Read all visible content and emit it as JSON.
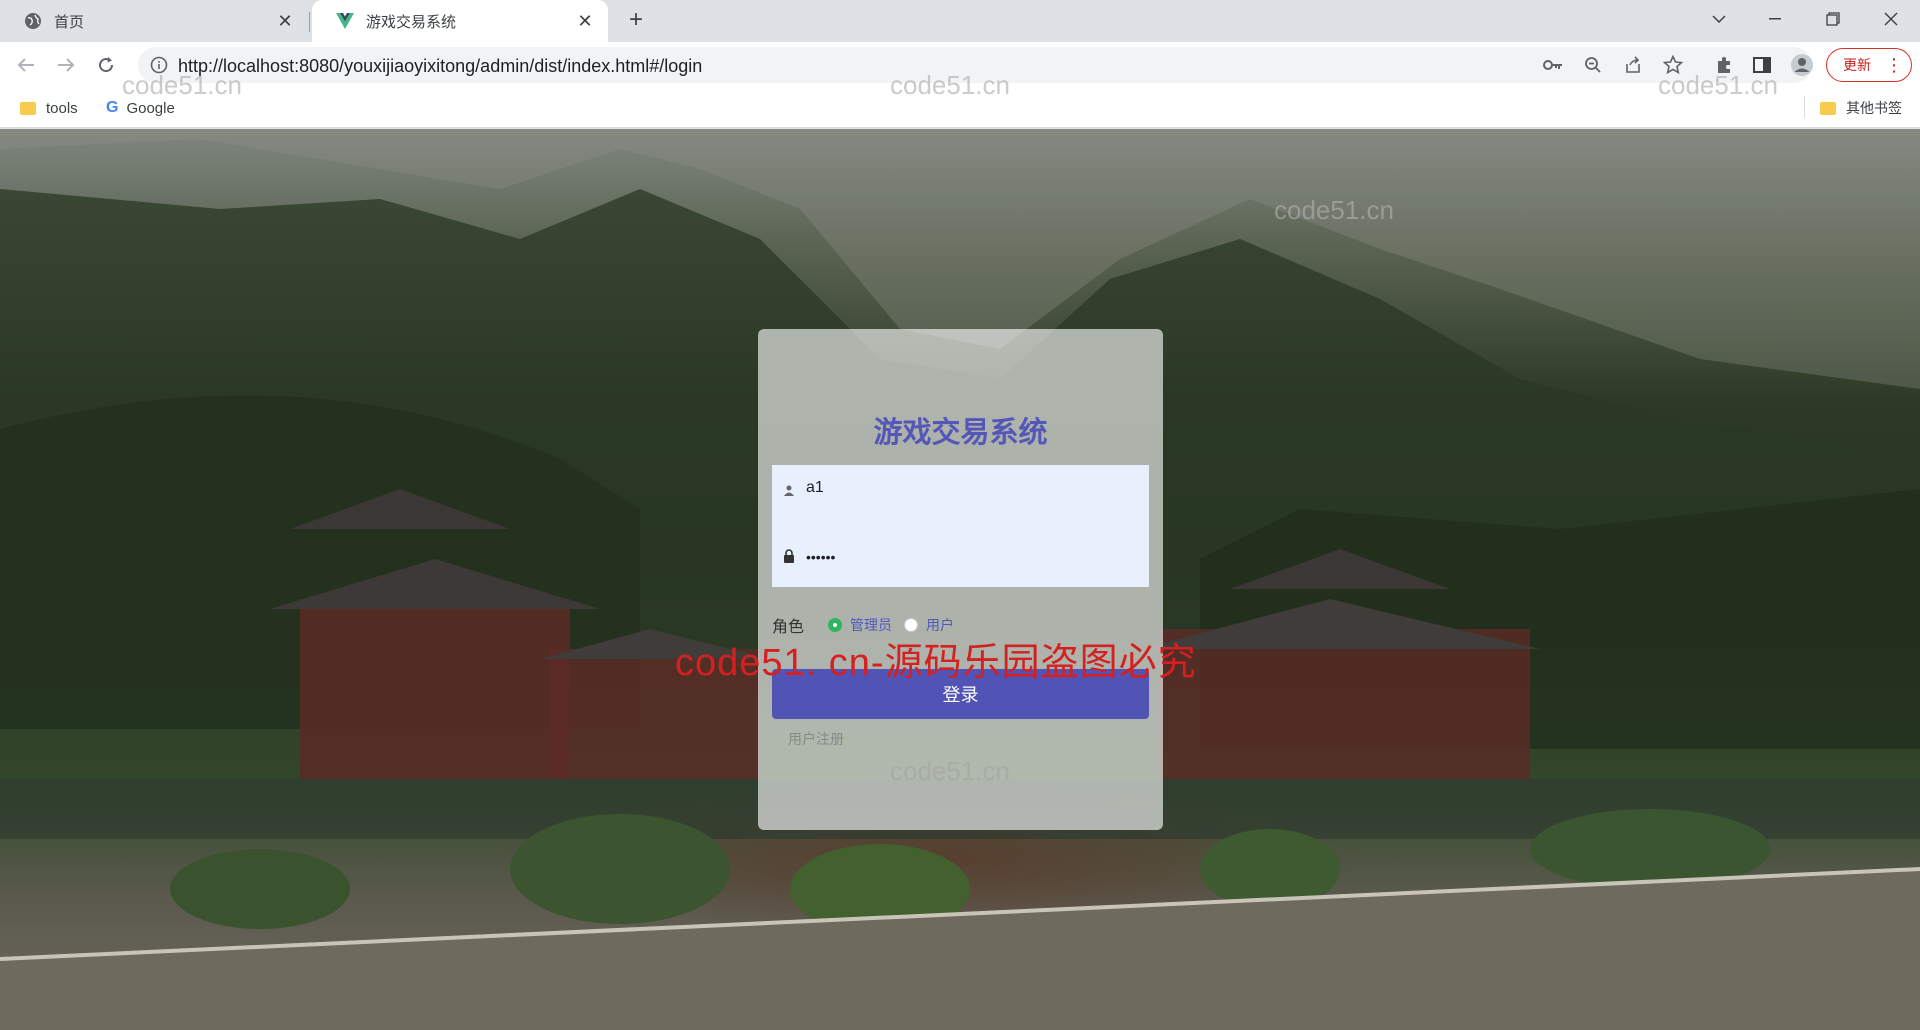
{
  "browser": {
    "tabs": [
      {
        "title": "首页",
        "icon": "globe-icon",
        "active": false
      },
      {
        "title": "游戏交易系统",
        "icon": "vue-logo-icon",
        "active": true
      }
    ],
    "address": {
      "url": "http://localhost:8080/youxijiaoyixitong/admin/dist/index.html#/login"
    },
    "update_label": "更新",
    "bookmarks": [
      {
        "label": "tools",
        "icon": "folder-icon"
      },
      {
        "label": "Google",
        "icon": "google-icon"
      }
    ],
    "other_bookmarks": "其他书签"
  },
  "login": {
    "title": "游戏交易系统",
    "username": "a1",
    "password": "••••••",
    "role_label": "角色",
    "roles": [
      {
        "label": "管理员",
        "selected": true
      },
      {
        "label": "用户",
        "selected": false
      }
    ],
    "submit_label": "登录",
    "register_label": "用户注册"
  },
  "watermarks": {
    "site": "code51.cn",
    "banner": "code51. cn-源码乐园盗图必究"
  },
  "colors": {
    "accent": "#5153b5",
    "title": "#5557b8",
    "radio_selected": "#2fb55f",
    "banner": "#d42020"
  }
}
